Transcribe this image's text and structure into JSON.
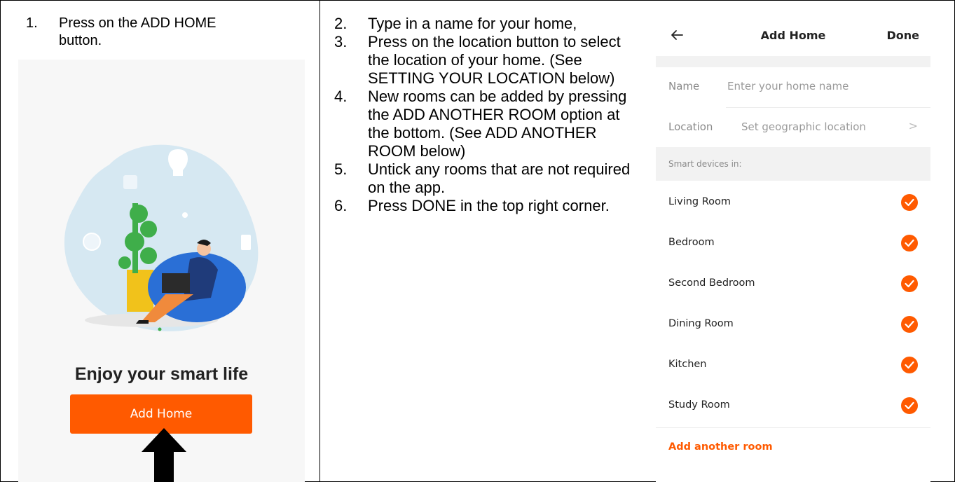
{
  "left": {
    "step_number": "1.",
    "step_text_line1": "Press on the ADD HOME",
    "step_text_line2": "button.",
    "tagline": "Enjoy your smart life",
    "add_home_button": "Add Home"
  },
  "middle": {
    "steps": [
      {
        "num": "2.",
        "text": "Type in a name for your home,"
      },
      {
        "num": "3.",
        "text": "Press on the location button to select the location of your home.  (See SETTING YOUR LOCATION below)"
      },
      {
        "num": "4.",
        "text": "New rooms can be added by pressing the ADD ANOTHER ROOM option at the bottom. (See ADD ANOTHER ROOM below)"
      },
      {
        "num": "5.",
        "text": "Untick any rooms that are not required on the app."
      },
      {
        "num": "6.",
        "text": "Press DONE in the top right corner."
      }
    ]
  },
  "screen": {
    "title": "Add Home",
    "done_label": "Done",
    "name_label": "Name",
    "name_placeholder": "Enter your home name",
    "location_label": "Location",
    "location_value": "Set geographic location",
    "chevron": ">",
    "section_header": "Smart devices in:",
    "rooms": [
      "Living Room",
      "Bedroom",
      "Second Bedroom",
      "Dining Room",
      "Kitchen",
      "Study Room"
    ],
    "add_room_label": "Add another room"
  },
  "colors": {
    "accent": "#ff5a00",
    "panel_bg": "#f7f7f7",
    "section_bg": "#f2f2f2"
  }
}
